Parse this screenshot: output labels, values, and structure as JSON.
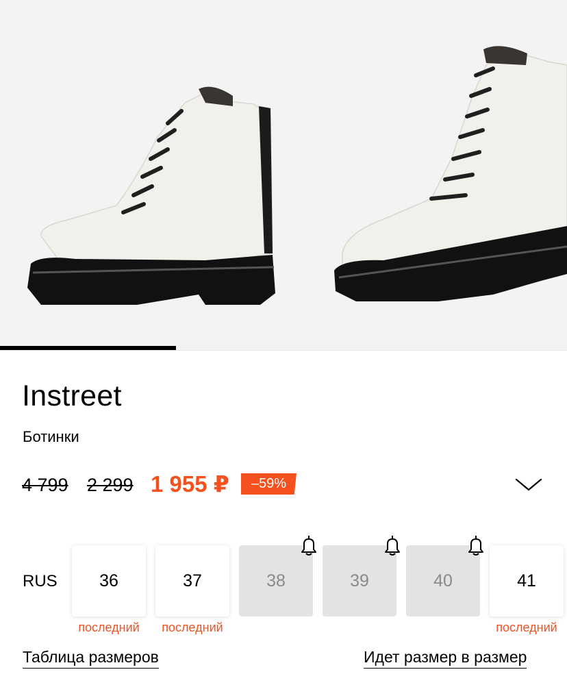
{
  "gallery": {
    "images": [
      {
        "alt": "boot-side-view"
      },
      {
        "alt": "boot-angle-view"
      }
    ],
    "progress": 0.31
  },
  "product": {
    "brand": "Instreet",
    "category": "Ботинки"
  },
  "price": {
    "original": "4 799",
    "previous": "2 299",
    "current": "1 955 ₽",
    "discount": "–59%",
    "accent_color": "#f4511e"
  },
  "sizes": {
    "system_label": "RUS",
    "items": [
      {
        "value": "36",
        "available": true,
        "tag": "последний"
      },
      {
        "value": "37",
        "available": true,
        "tag": "последний"
      },
      {
        "value": "38",
        "available": false,
        "tag": ""
      },
      {
        "value": "39",
        "available": false,
        "tag": ""
      },
      {
        "value": "40",
        "available": false,
        "tag": ""
      },
      {
        "value": "41",
        "available": true,
        "tag": "последний"
      }
    ]
  },
  "links": {
    "size_table": "Таблица размеров",
    "fit": "Идет размер в размер"
  },
  "icons": {
    "expand": "chevron-down-icon",
    "notify": "bell-icon"
  }
}
